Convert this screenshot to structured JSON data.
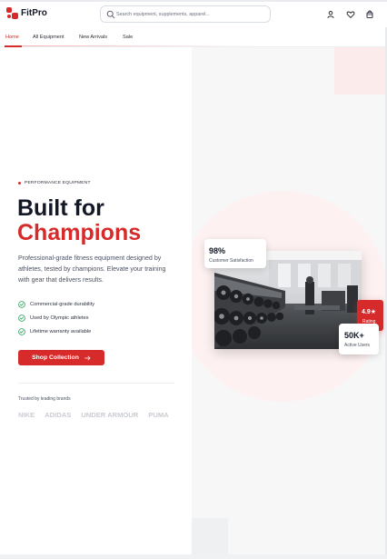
{
  "brand": {
    "name": "FitPro"
  },
  "search": {
    "placeholder": "Search equipment, supplements, apparel..."
  },
  "header_icons": [
    "user-icon",
    "heart-icon",
    "cart-icon"
  ],
  "nav": {
    "items": [
      {
        "label": "Home",
        "active": true
      },
      {
        "label": "All Equipment",
        "active": false
      },
      {
        "label": "New Arrivals",
        "active": false
      },
      {
        "label": "Sale",
        "active": false
      }
    ]
  },
  "hero": {
    "badge": "PERFORMANCE EQUIPMENT",
    "title_line1": "Built for",
    "title_line2": "Champions",
    "description": "Professional-grade fitness equipment designed by athletes, tested by champions. Elevate your training with gear that delivers results.",
    "features": [
      "Commercial-grade durability",
      "Used by Olympic athletes",
      "Lifetime warranty available"
    ],
    "cta_label": "Shop Collection",
    "trusted_label": "Trusted by leading brands",
    "brands": [
      "NIKE",
      "ADIDAS",
      "UNDER ARMOUR",
      "PUMA"
    ]
  },
  "stats": {
    "satisfaction": {
      "value": "98%",
      "label": "Customer Satisfaction"
    },
    "rating": {
      "value": "4.9★",
      "label": "Rating"
    },
    "users": {
      "value": "50K+",
      "label": "Active Users"
    }
  },
  "colors": {
    "accent": "#d72a2a",
    "text_dark": "#121826",
    "brand_gray": "#c9ccd3",
    "panel_bg": "#f7f7f8"
  }
}
